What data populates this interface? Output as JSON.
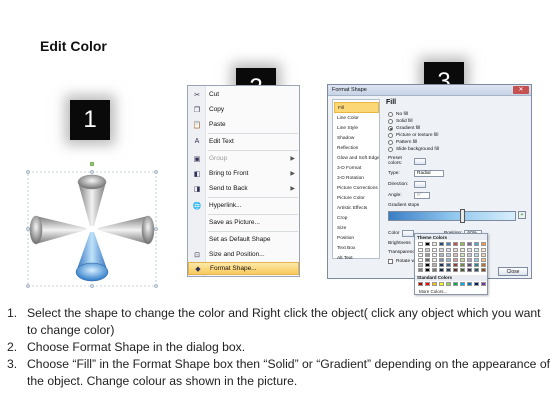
{
  "title": "Edit Color",
  "badges": [
    "1",
    "2",
    "3"
  ],
  "context_menu": {
    "items": [
      {
        "label": "Cut",
        "icon": "scissors-icon",
        "glyph": "✂"
      },
      {
        "label": "Copy",
        "icon": "copy-icon",
        "glyph": "❐"
      },
      {
        "label": "Paste",
        "icon": "paste-icon",
        "glyph": "📋"
      },
      {
        "label": "Edit Text",
        "icon": "edit-text-icon",
        "glyph": "A"
      },
      {
        "label": "Group",
        "icon": "group-icon",
        "glyph": "▣",
        "disabled": true,
        "submenu": true
      },
      {
        "label": "Bring to Front",
        "icon": "bring-front-icon",
        "glyph": "◧",
        "submenu": true
      },
      {
        "label": "Send to Back",
        "icon": "send-back-icon",
        "glyph": "◨",
        "submenu": true
      },
      {
        "label": "Hyperlink...",
        "icon": "hyperlink-icon",
        "glyph": "🌐"
      },
      {
        "label": "Save as Picture...",
        "icon": "",
        "glyph": ""
      },
      {
        "label": "Set as Default Shape",
        "icon": "",
        "glyph": ""
      },
      {
        "label": "Size and Position...",
        "icon": "size-position-icon",
        "glyph": "⊡"
      },
      {
        "label": "Format Shape...",
        "icon": "format-shape-icon",
        "glyph": "◆",
        "highlighted": true
      }
    ]
  },
  "dialog": {
    "title": "Format Shape",
    "nav": [
      "Fill",
      "Line Color",
      "Line Style",
      "Shadow",
      "Reflection",
      "Glow and Soft Edges",
      "3-D Format",
      "3-D Rotation",
      "Picture Corrections",
      "Picture Color",
      "Artistic Effects",
      "Crop",
      "Size",
      "Position",
      "Text Box",
      "Alt Text"
    ],
    "fill_heading": "Fill",
    "fill_options": [
      {
        "label": "No fill",
        "selected": false
      },
      {
        "label": "Solid fill",
        "selected": false
      },
      {
        "label": "Gradient fill",
        "selected": true
      },
      {
        "label": "Picture or texture fill",
        "selected": false
      },
      {
        "label": "Pattern fill",
        "selected": false
      },
      {
        "label": "Slide background fill",
        "selected": false
      }
    ],
    "preset_label": "Preset colors:",
    "type_label": "Type:",
    "type_value": "Radial",
    "direction_label": "Direction:",
    "angle_label": "Angle:",
    "angle_value": "0°",
    "gradient_stops_label": "Gradient stops",
    "color_label": "Color",
    "position_label": "Position:",
    "position_value": "60%",
    "brightness_label": "Brightness",
    "transparency_label": "Transparency",
    "rotate_label": "Rotate w",
    "close_label": "Close"
  },
  "color_picker": {
    "theme_label": "Theme Colors",
    "standard_label": "Standard Colors",
    "more_label": "More Colors...",
    "theme_top": [
      "#ffffff",
      "#000000",
      "#eeece1",
      "#1f497d",
      "#4f81bd",
      "#c0504d",
      "#9bbb59",
      "#8064a2",
      "#4bacc6",
      "#f79646"
    ],
    "standard": [
      "#c00000",
      "#ff0000",
      "#ffc000",
      "#ffff00",
      "#92d050",
      "#00b050",
      "#00b0f0",
      "#0070c0",
      "#002060",
      "#7030a0"
    ]
  },
  "instructions": [
    {
      "num": "1.",
      "text": "Select the shape to change the color and Right click the object( click any object which you want to change color)"
    },
    {
      "num": "2.",
      "text": "Choose Format Shape in the dialog box."
    },
    {
      "num": "3.",
      "text": "Choose “Fill” in the Format Shape box then “Solid” or “Gradient” depending on the appearance of the object. Change colour as shown in the picture."
    }
  ]
}
